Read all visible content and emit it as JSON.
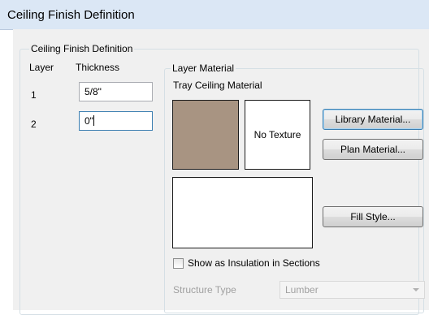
{
  "window": {
    "title": "Ceiling Finish Definition"
  },
  "finish_group": {
    "label": "Ceiling Finish Definition",
    "col_layer": "Layer",
    "col_thickness": "Thickness",
    "rows": [
      {
        "layer": "1",
        "thickness": "5/8\""
      },
      {
        "layer": "2",
        "thickness": "0\""
      }
    ]
  },
  "material_group": {
    "label": "Layer Material",
    "material_name": "Tray Ceiling Material",
    "color_swatch": "#a89482",
    "no_texture_text": "No Texture",
    "library_button": "Library Material...",
    "plan_button": "Plan Material...",
    "fill_button": "Fill Style...",
    "insulation_checkbox": "Show as Insulation in Sections",
    "insulation_checked": false,
    "structure_label": "Structure Type",
    "structure_value": "Lumber"
  }
}
